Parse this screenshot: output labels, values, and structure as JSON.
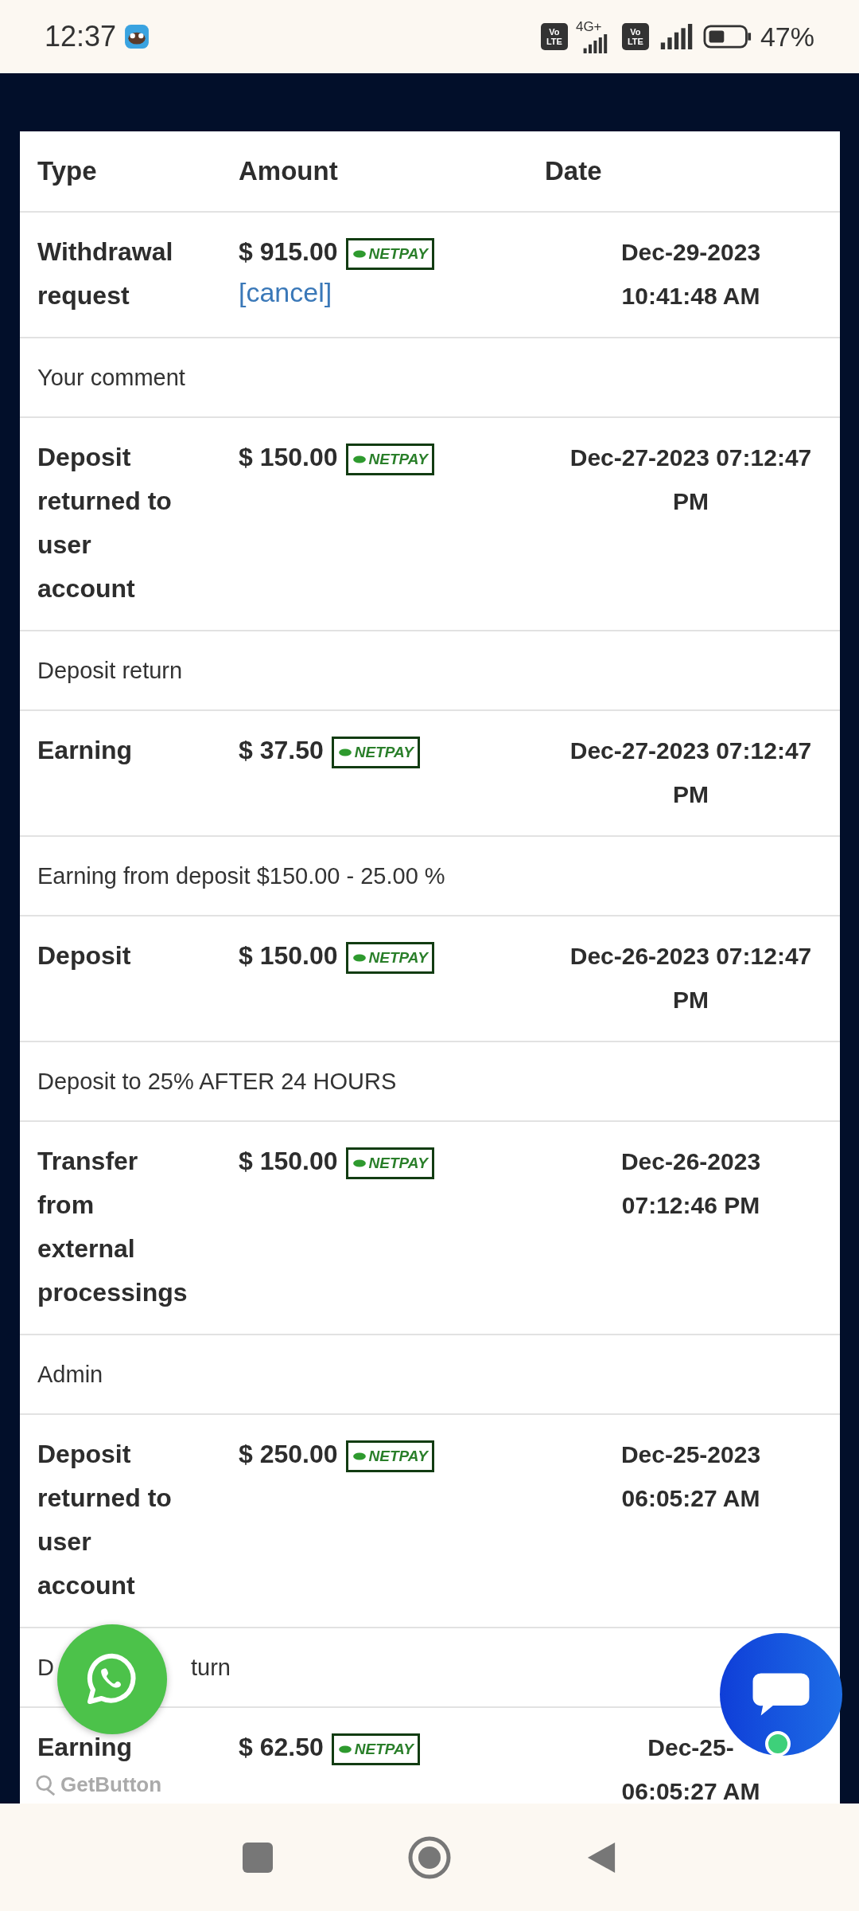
{
  "status_bar": {
    "time": "12:37",
    "volte_badges": [
      "Vo LTE",
      "Vo LTE"
    ],
    "network": "4G+",
    "battery": "47%"
  },
  "table": {
    "columns": [
      "Type",
      "Amount",
      "Date"
    ],
    "rows": [
      {
        "type": "Withdrawal\nrequest",
        "amount": "$ 915.00",
        "method": "NETPAY",
        "action": "[cancel]",
        "date": "Dec-29-2023\n10:41:48 AM",
        "comment": [
          "Your comment"
        ]
      },
      {
        "type": "Deposit\nreturned to\nuser\naccount",
        "amount": "$ 150.00",
        "method": "NETPAY",
        "date": "Dec-27-2023 07:12:47\nPM",
        "comment": [
          "Deposit return"
        ]
      },
      {
        "type": "Earning",
        "amount": "$ 37.50",
        "method": "NETPAY",
        "date": "Dec-27-2023 07:12:47\nPM",
        "comment": [
          "Earning from deposit $150.00 - 25.00 %"
        ]
      },
      {
        "type": "Deposit",
        "amount": "$ 150.00",
        "method": "NETPAY",
        "date": "Dec-26-2023 07:12:47\nPM",
        "comment": [
          "Deposit to 25% AFTER 24 HOURS"
        ]
      },
      {
        "type": "Transfer\nfrom\nexternal\nprocessings",
        "amount": "$ 150.00",
        "method": "NETPAY",
        "date": "Dec-26-2023\n07:12:46 PM",
        "comment": [
          "Admin"
        ]
      },
      {
        "type": "Deposit\nreturned to\nuser\naccount",
        "amount": "$ 250.00",
        "method": "NETPAY",
        "date": "Dec-25-2023\n06:05:27 AM",
        "comment": [
          "D",
          "turn"
        ]
      },
      {
        "type": "Earning",
        "amount": "$ 62.50",
        "method": "NETPAY",
        "date": "Dec-25-\n06:05:27 AM"
      }
    ]
  },
  "whatsapp_widget": {
    "label": "GetButton"
  }
}
